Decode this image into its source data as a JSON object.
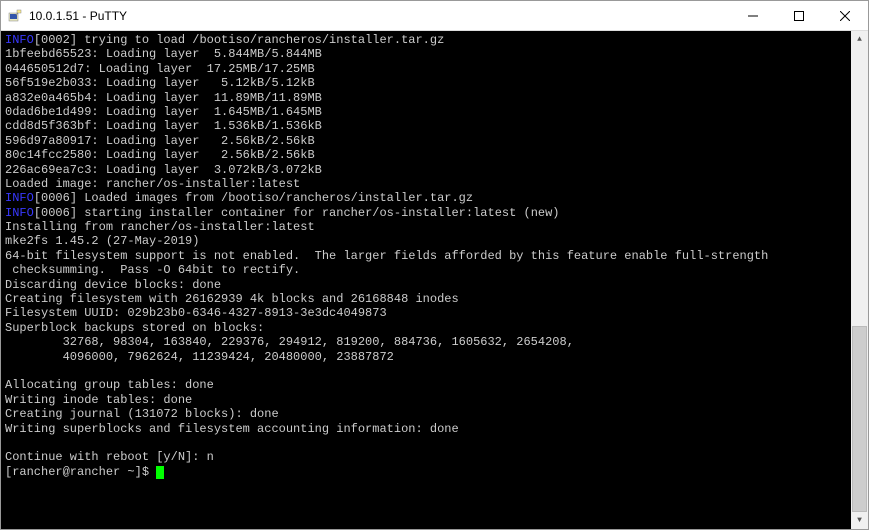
{
  "titlebar": {
    "title": "10.0.1.51 - PuTTY"
  },
  "terminal": {
    "lines": [
      {
        "type": "info",
        "tag": "INFO",
        "text": "[0002] trying to load /bootiso/rancheros/installer.tar.gz"
      },
      {
        "type": "plain",
        "text": "1bfeebd65523: Loading layer  5.844MB/5.844MB"
      },
      {
        "type": "plain",
        "text": "044650512d7: Loading layer  17.25MB/17.25MB"
      },
      {
        "type": "plain",
        "text": "56f519e2b033: Loading layer   5.12kB/5.12kB"
      },
      {
        "type": "plain",
        "text": "a832e0a465b4: Loading layer  11.89MB/11.89MB"
      },
      {
        "type": "plain",
        "text": "0dad6be1d499: Loading layer  1.645MB/1.645MB"
      },
      {
        "type": "plain",
        "text": "cdd8d5f363bf: Loading layer  1.536kB/1.536kB"
      },
      {
        "type": "plain",
        "text": "596d97a80917: Loading layer   2.56kB/2.56kB"
      },
      {
        "type": "plain",
        "text": "80c14fcc2580: Loading layer   2.56kB/2.56kB"
      },
      {
        "type": "plain",
        "text": "226ac69ea7c3: Loading layer  3.072kB/3.072kB"
      },
      {
        "type": "plain",
        "text": "Loaded image: rancher/os-installer:latest"
      },
      {
        "type": "info",
        "tag": "INFO",
        "text": "[0006] Loaded images from /bootiso/rancheros/installer.tar.gz"
      },
      {
        "type": "info",
        "tag": "INFO",
        "text": "[0006] starting installer container for rancher/os-installer:latest (new)"
      },
      {
        "type": "plain",
        "text": "Installing from rancher/os-installer:latest"
      },
      {
        "type": "plain",
        "text": "mke2fs 1.45.2 (27-May-2019)"
      },
      {
        "type": "plain",
        "text": "64-bit filesystem support is not enabled.  The larger fields afforded by this feature enable full-strength"
      },
      {
        "type": "plain",
        "text": " checksumming.  Pass -O 64bit to rectify."
      },
      {
        "type": "plain",
        "text": "Discarding device blocks: done"
      },
      {
        "type": "plain",
        "text": "Creating filesystem with 26162939 4k blocks and 26168848 inodes"
      },
      {
        "type": "plain",
        "text": "Filesystem UUID: 029b23b0-6346-4327-8913-3e3dc4049873"
      },
      {
        "type": "plain",
        "text": "Superblock backups stored on blocks:"
      },
      {
        "type": "plain",
        "text": "        32768, 98304, 163840, 229376, 294912, 819200, 884736, 1605632, 2654208,"
      },
      {
        "type": "plain",
        "text": "        4096000, 7962624, 11239424, 20480000, 23887872"
      },
      {
        "type": "plain",
        "text": ""
      },
      {
        "type": "plain",
        "text": "Allocating group tables: done"
      },
      {
        "type": "plain",
        "text": "Writing inode tables: done"
      },
      {
        "type": "plain",
        "text": "Creating journal (131072 blocks): done"
      },
      {
        "type": "plain",
        "text": "Writing superblocks and filesystem accounting information: done"
      },
      {
        "type": "plain",
        "text": ""
      },
      {
        "type": "plain",
        "text": "Continue with reboot [y/N]: n"
      }
    ],
    "prompt": "[rancher@rancher ~]$ "
  }
}
